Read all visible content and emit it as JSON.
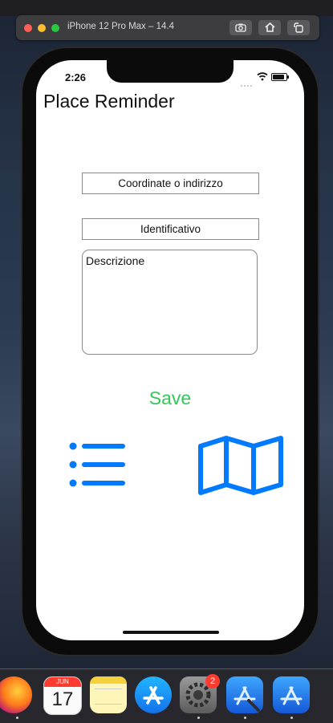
{
  "simulator": {
    "title": "iPhone 12 Pro Max – 14.4",
    "buttons": [
      "screenshot-button",
      "home-button",
      "rotate-button"
    ]
  },
  "status_bar": {
    "time": "2:26"
  },
  "app": {
    "title": "Place Reminder",
    "coordinate_placeholder": "Coordinate o indirizzo",
    "identifier_placeholder": "Identificativo",
    "description_text": "Descrizione",
    "save_label": "Save",
    "accent_color": "#007aff",
    "save_color": "#34c759"
  },
  "dock": {
    "calendar_month": "JUN",
    "calendar_day": "17",
    "settings_badge": "2",
    "apps": [
      "firefox-icon",
      "calendar-icon",
      "notes-icon",
      "app-store-icon",
      "system-preferences-icon",
      "xcode-icon",
      "instruments-icon"
    ]
  }
}
